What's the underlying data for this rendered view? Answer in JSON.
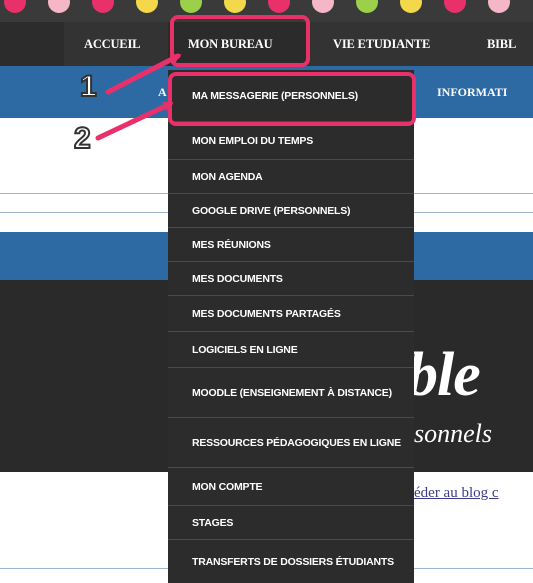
{
  "colors": {
    "nav_bg": "#333333",
    "blue": "#2d6aa3",
    "dropdown_bg": "#2c2c2c",
    "highlight": "#e8306b",
    "dots": [
      "#e8306b",
      "#f5b6c8",
      "#e8306b",
      "#f2d84a",
      "#9ccf4a",
      "#f2d84a",
      "#e8306b",
      "#f5b6c8",
      "#9ccf4a",
      "#f2d84a",
      "#e8306b",
      "#f5b6c8"
    ]
  },
  "nav": {
    "items": [
      "ACCUEIL",
      "MON BUREAU",
      "VIE ETUDIANTE",
      "BIBL"
    ]
  },
  "subnav": {
    "left_fragment": "A",
    "right_fragment": "INFORMATI"
  },
  "dropdown": {
    "items": [
      "MA MESSAGERIE (PERSONNELS)",
      "MON EMPLOI DU TEMPS",
      "MON AGENDA",
      "GOOGLE DRIVE (PERSONNELS)",
      "MES RÉUNIONS",
      "MES DOCUMENTS",
      "MES DOCUMENTS PARTAGÉS",
      "LOGICIELS EN LIGNE",
      "MOODLE (ENSEIGNEMENT À DISTANCE)",
      "RESSOURCES PÉDAGOGIQUES EN LIGNE",
      "MON COMPTE",
      "STAGES",
      "TRANSFERTS DE DOSSIERS ÉTUDIANTS"
    ]
  },
  "banner": {
    "big_text": "ble",
    "sub_text": "sonnels"
  },
  "link": {
    "text": "éder au blog c"
  },
  "annotations": {
    "one": "1",
    "two": "2"
  }
}
